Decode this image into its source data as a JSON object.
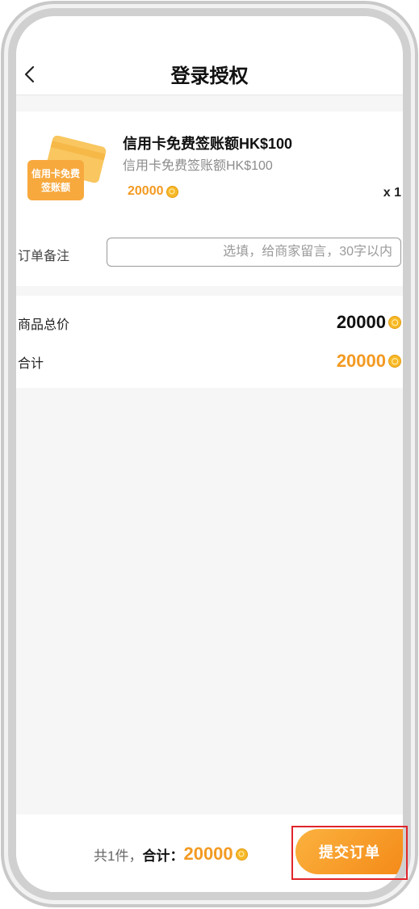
{
  "header": {
    "title": "登录授权"
  },
  "product": {
    "thumb_line1": "信用卡免费",
    "thumb_line2": "签账额",
    "title": "信用卡免费签账额HK$100",
    "subtitle": "信用卡免费签账额HK$100",
    "price": "20000",
    "quantity": "x 1"
  },
  "remark": {
    "label": "订单备注",
    "placeholder": "选填，给商家留言，30字以内",
    "value": ""
  },
  "totals": {
    "goods_total_label": "商品总价",
    "goods_total_value": "20000",
    "total_label": "合计",
    "total_value": "20000"
  },
  "bottom_bar": {
    "count_text": "共1件，",
    "total_label": "合计：",
    "total_value": "20000",
    "submit_label": "提交订单"
  },
  "colors": {
    "accent": "#f39a22",
    "highlight": "#e0252b",
    "coin": "#f7b928"
  },
  "icons": {
    "back": "chevron-left-icon",
    "coin": "coin-icon"
  }
}
